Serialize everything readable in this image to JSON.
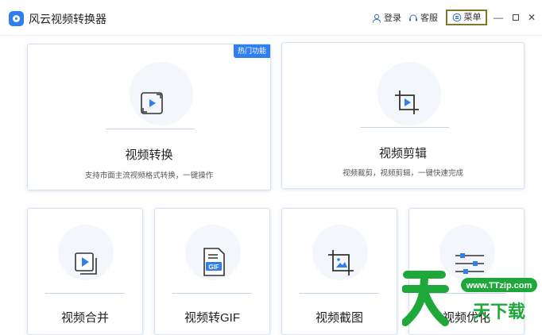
{
  "app": {
    "title": "风云视频转换器"
  },
  "toolbar": {
    "login": "登录",
    "service": "客服",
    "menu": "菜单"
  },
  "cards": {
    "convert": {
      "title": "视频转换",
      "desc": "支持市面主流视频格式转换，一键操作",
      "badge": "热门功能"
    },
    "edit": {
      "title": "视频剪辑",
      "desc": "视频裁剪，视频剪辑，一键快速完成"
    },
    "merge": {
      "title": "视频合并"
    },
    "gif": {
      "title": "视频转GIF",
      "icon_label": "GIF"
    },
    "screenshot": {
      "title": "视频截图"
    },
    "optimize": {
      "title": "视频优化"
    }
  },
  "watermark": {
    "url": "www.TTzip.com",
    "text": "天下载"
  },
  "colors": {
    "accent": "#2f7ff0",
    "watermark_green": "#1fa83a"
  }
}
